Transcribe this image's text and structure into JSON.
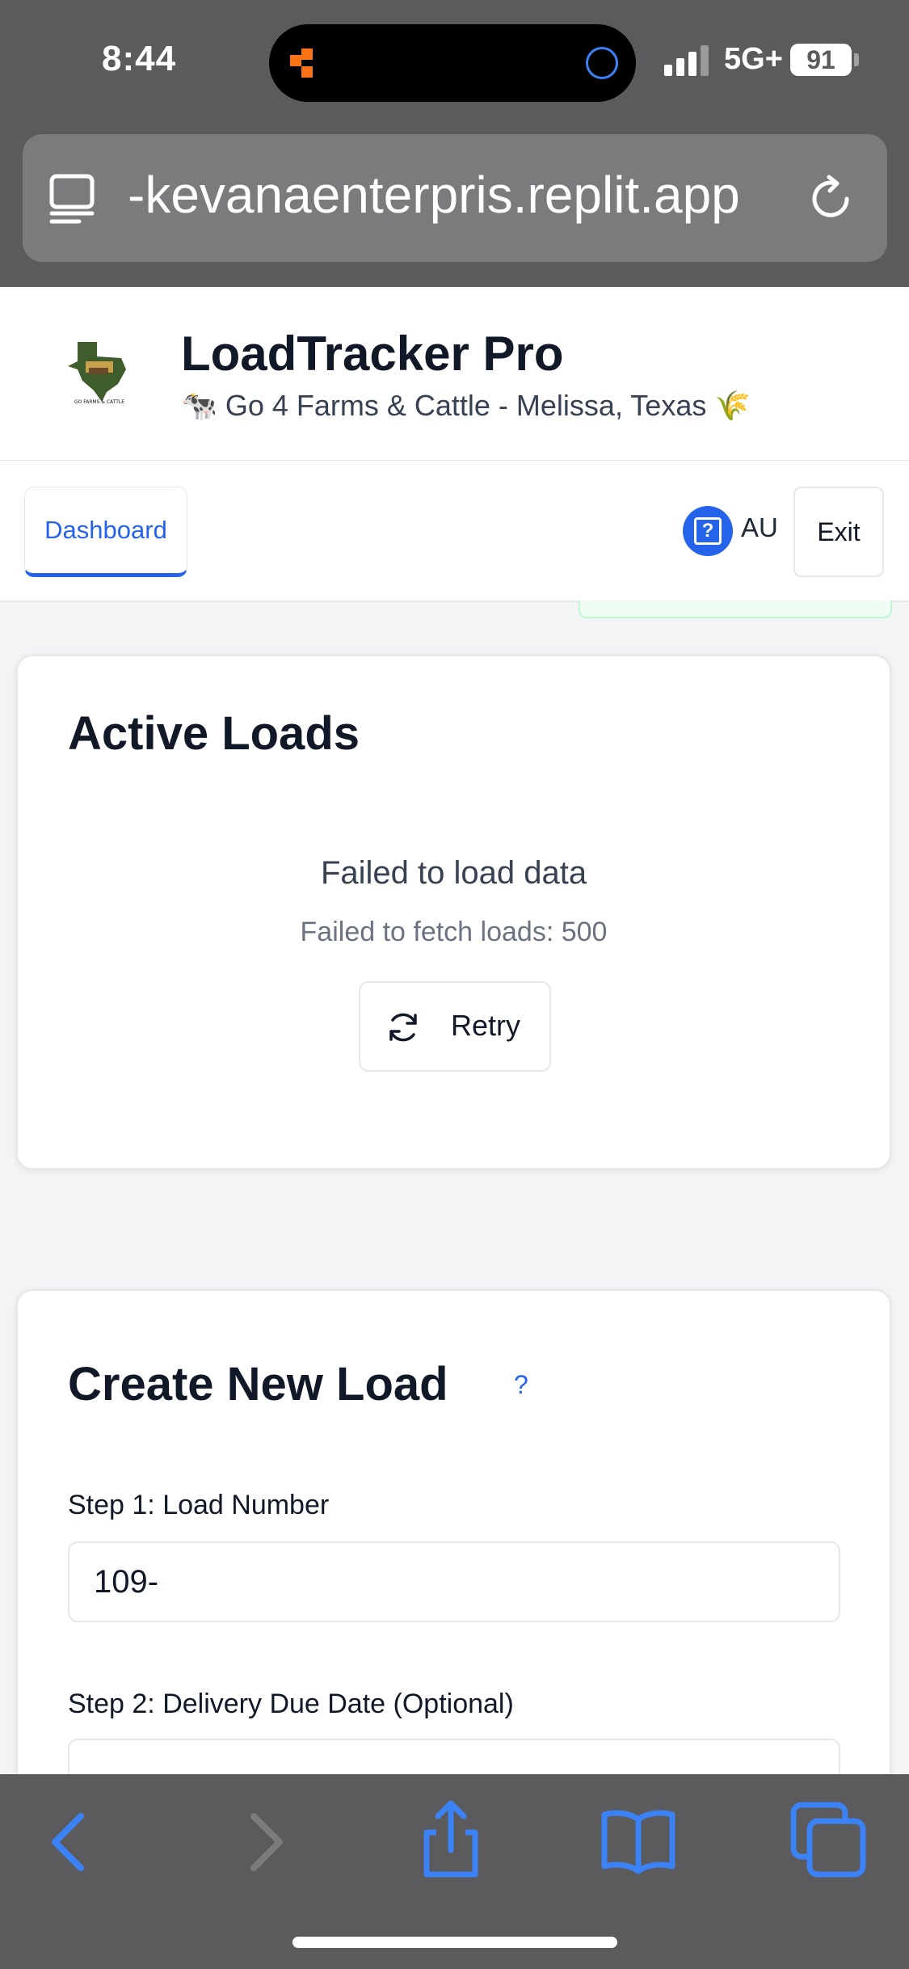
{
  "status_bar": {
    "time": "8:44",
    "network": "5G+",
    "battery": "91"
  },
  "browser": {
    "url": "-kevanaenterpris.replit.app"
  },
  "header": {
    "title": "LoadTracker Pro",
    "subtitle": "🐄 Go 4 Farms & Cattle - Melissa, Texas 🌾",
    "logo_text": "GO FARMS & CATTLE"
  },
  "nav": {
    "tab_dashboard": "Dashboard",
    "help_icon_label": "?",
    "user_initials": "AU",
    "exit_label": "Exit"
  },
  "active_loads": {
    "title": "Active Loads",
    "error_title": "Failed to load data",
    "error_detail": "Failed to fetch loads: 500",
    "retry_label": "Retry"
  },
  "create_load": {
    "title": "Create New Load",
    "help_label": "?",
    "step1_label": "Step 1: Load Number",
    "step1_value": "109-",
    "step2_label": "Step 2: Delivery Due Date (Optional)",
    "step2_value": ""
  },
  "colors": {
    "accent": "#2563eb",
    "browser_chrome": "#5b5b5d"
  },
  "icons": [
    "reader-icon",
    "reload-icon",
    "help-icon",
    "refresh-icon",
    "back-icon",
    "forward-icon",
    "share-icon",
    "bookmarks-icon",
    "tabs-icon"
  ]
}
